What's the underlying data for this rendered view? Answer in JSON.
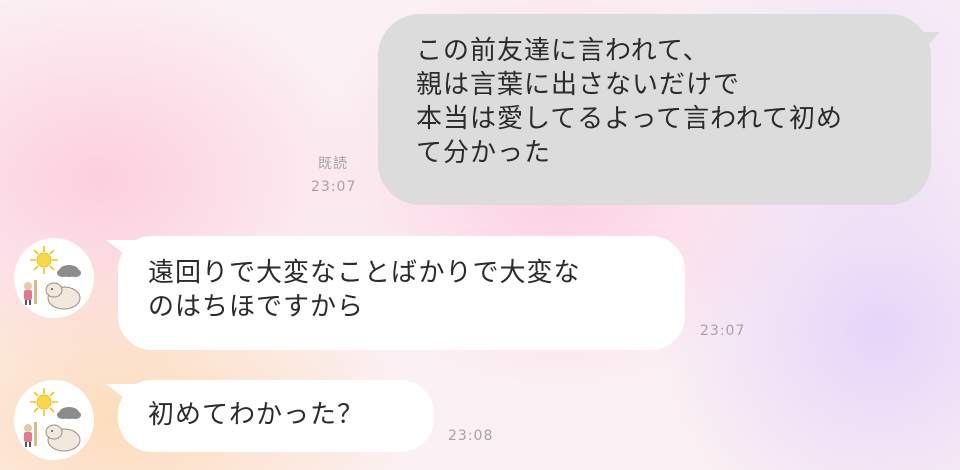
{
  "messages": {
    "outgoing": {
      "lines": [
        "この前友達に言われて、",
        "親は言葉に出さないだけで",
        "本当は愛してるよって言われて初め",
        "て分かった"
      ],
      "read_label": "既読",
      "time": "23:07"
    },
    "incoming_1": {
      "lines": [
        "遠回りで大変なことばかりで大変な",
        "のはちほですから"
      ],
      "time": "23:07"
    },
    "incoming_2": {
      "lines": [
        "初めてわかった？"
      ],
      "time": "23:08"
    }
  },
  "colors": {
    "outgoing_bubble": "#dcdcdd",
    "incoming_bubble": "#ffffff",
    "meta_text": "#a7a0a8"
  },
  "icons": {
    "avatar": "avatar-sun-and-character-icon"
  }
}
